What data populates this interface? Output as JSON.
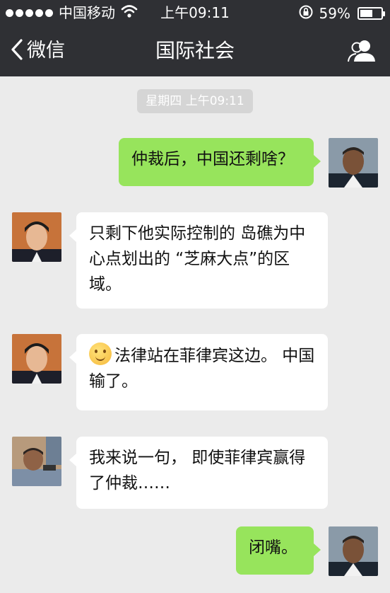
{
  "status_bar": {
    "carrier": "中国移动",
    "time": "上午09:11",
    "battery_percent": "59%",
    "battery_level": 0.59
  },
  "nav": {
    "back_label": "微信",
    "title": "国际社会"
  },
  "chat": {
    "timestamp": "星期四 上午09:11",
    "messages": [
      {
        "side": "right",
        "text": "仲裁后，中国还剩啥？"
      },
      {
        "side": "left",
        "text": "只剩下他实际控制的 岛礁为中心点划出的 “芝麻大点”的区域。"
      },
      {
        "side": "left",
        "text": "法律站在菲律宾这边。 中国输了。"
      },
      {
        "side": "left",
        "text": "我来说一句， 即使菲律宾赢得了仲裁……"
      },
      {
        "side": "right",
        "text": "闭嘴。"
      }
    ]
  },
  "icons": {
    "back": "chevron-left-icon",
    "contact": "contacts-icon",
    "wifi": "wifi-icon",
    "lock": "rotation-lock-icon",
    "battery": "battery-icon"
  },
  "colors": {
    "bar": "#2f3034",
    "background": "#ebebeb",
    "bubble_me": "#97e45c",
    "bubble_other": "#ffffff"
  }
}
